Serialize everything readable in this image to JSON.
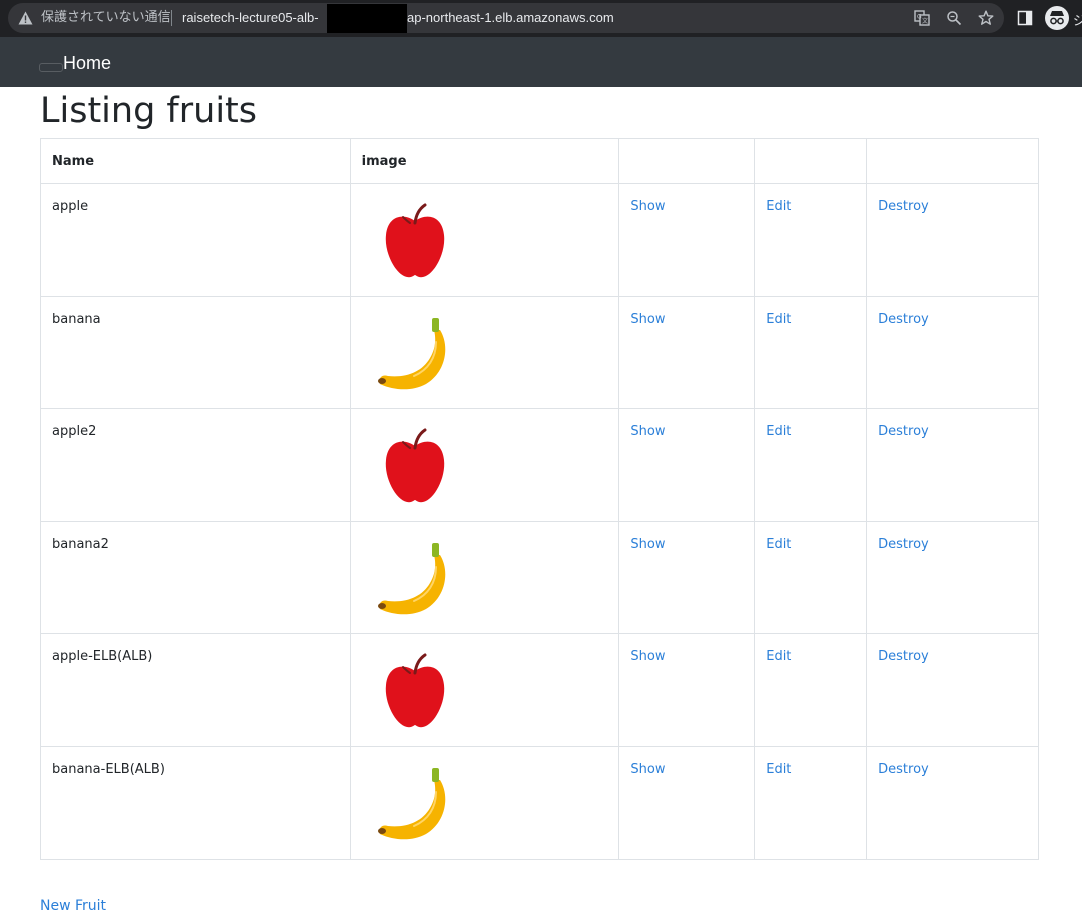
{
  "browser": {
    "security_label": "保護されていない通信",
    "url_host": "raisetech-lecture05-alb-",
    "url_domain": "ap-northeast-1.elb.amazonaws.com",
    "edge_glyph": "ジ"
  },
  "navbar": {
    "home_label": "Home"
  },
  "page": {
    "title": "Listing fruits"
  },
  "table": {
    "headers": {
      "name": "Name",
      "image": "image"
    },
    "rows": [
      {
        "name": "apple",
        "image": "apple-icon",
        "show": "Show",
        "edit": "Edit",
        "destroy": "Destroy"
      },
      {
        "name": "banana",
        "image": "banana-icon",
        "show": "Show",
        "edit": "Edit",
        "destroy": "Destroy"
      },
      {
        "name": "apple2",
        "image": "apple-icon",
        "show": "Show",
        "edit": "Edit",
        "destroy": "Destroy"
      },
      {
        "name": "banana2",
        "image": "banana-icon",
        "show": "Show",
        "edit": "Edit",
        "destroy": "Destroy"
      },
      {
        "name": "apple-ELB(ALB)",
        "image": "apple-icon",
        "show": "Show",
        "edit": "Edit",
        "destroy": "Destroy"
      },
      {
        "name": "banana-ELB(ALB)",
        "image": "banana-icon",
        "show": "Show",
        "edit": "Edit",
        "destroy": "Destroy"
      }
    ]
  },
  "footer": {
    "new_label": "New Fruit"
  },
  "colors": {
    "navbar": "#343a40",
    "link": "#2b7fd8",
    "apple": "#e0111b",
    "banana": "#f6b300"
  }
}
